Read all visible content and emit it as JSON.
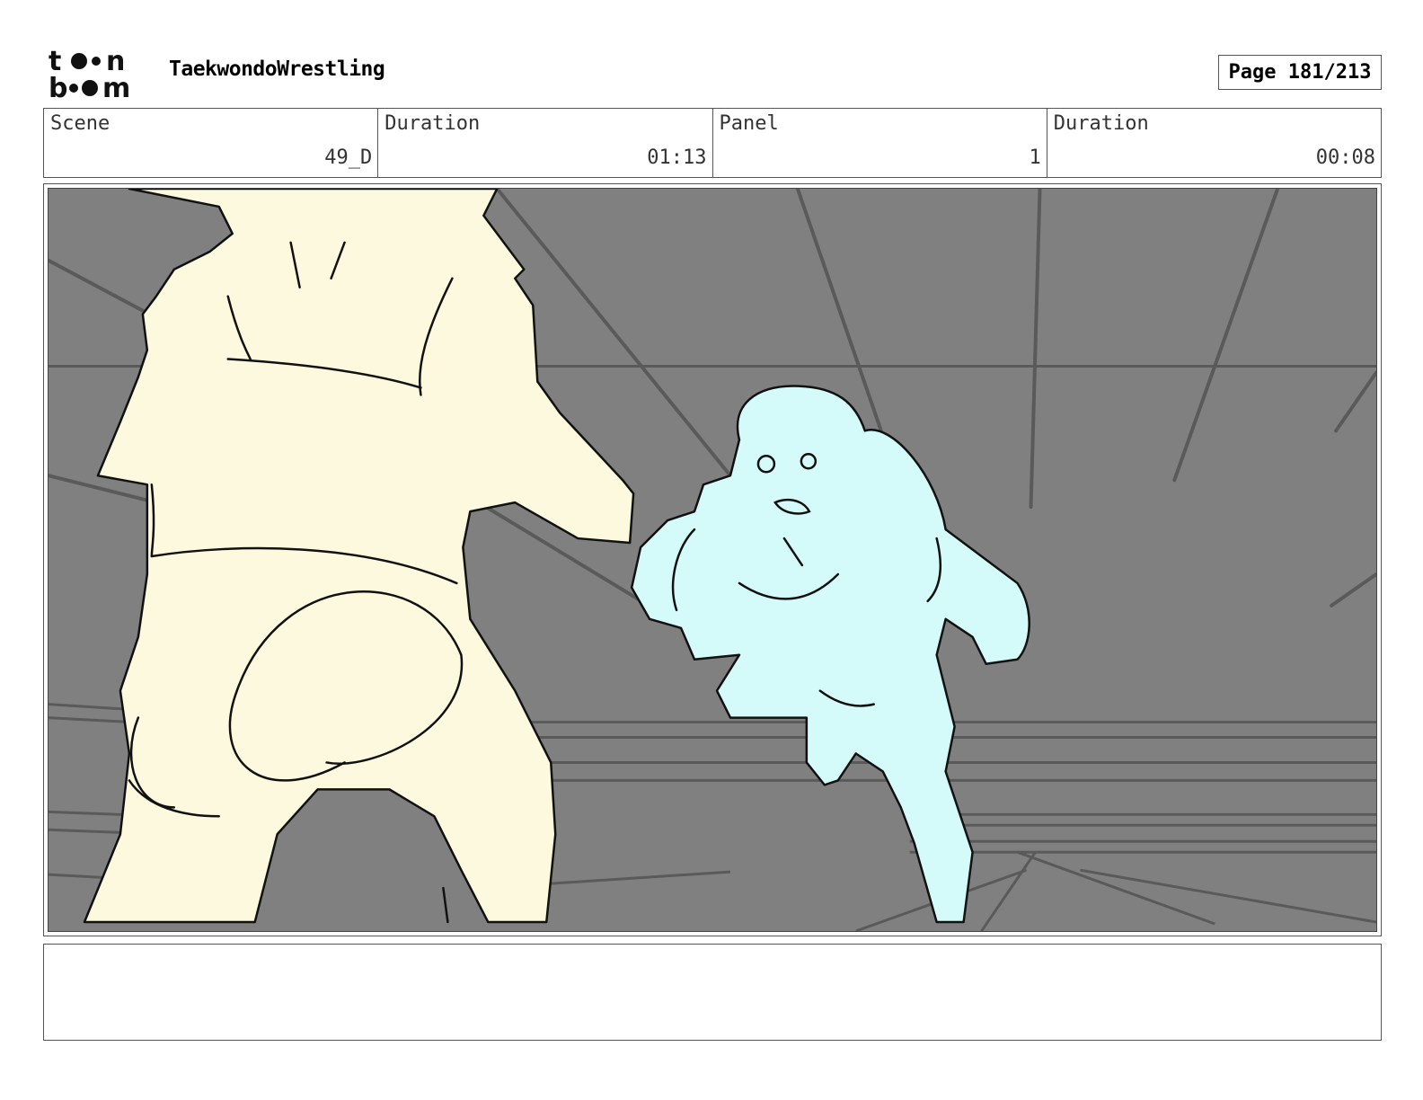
{
  "header": {
    "logo_text": "toon boom",
    "project_title": "TaekwondoWrestling",
    "page_label": "Page 181/213"
  },
  "info_bar": {
    "scene_label": "Scene",
    "scene_value": "49_D",
    "scene_duration_label": "Duration",
    "scene_duration_value": "01:13",
    "panel_label": "Panel",
    "panel_value": "1",
    "panel_duration_label": "Duration",
    "panel_duration_value": "00:08"
  },
  "colors": {
    "background_gray": "#808080",
    "character_front_fill": "#fdf9de",
    "character_back_fill": "#d4fbf9",
    "line": "#111111",
    "ring_line": "#5a5a5a"
  },
  "notes": {
    "text": ""
  }
}
